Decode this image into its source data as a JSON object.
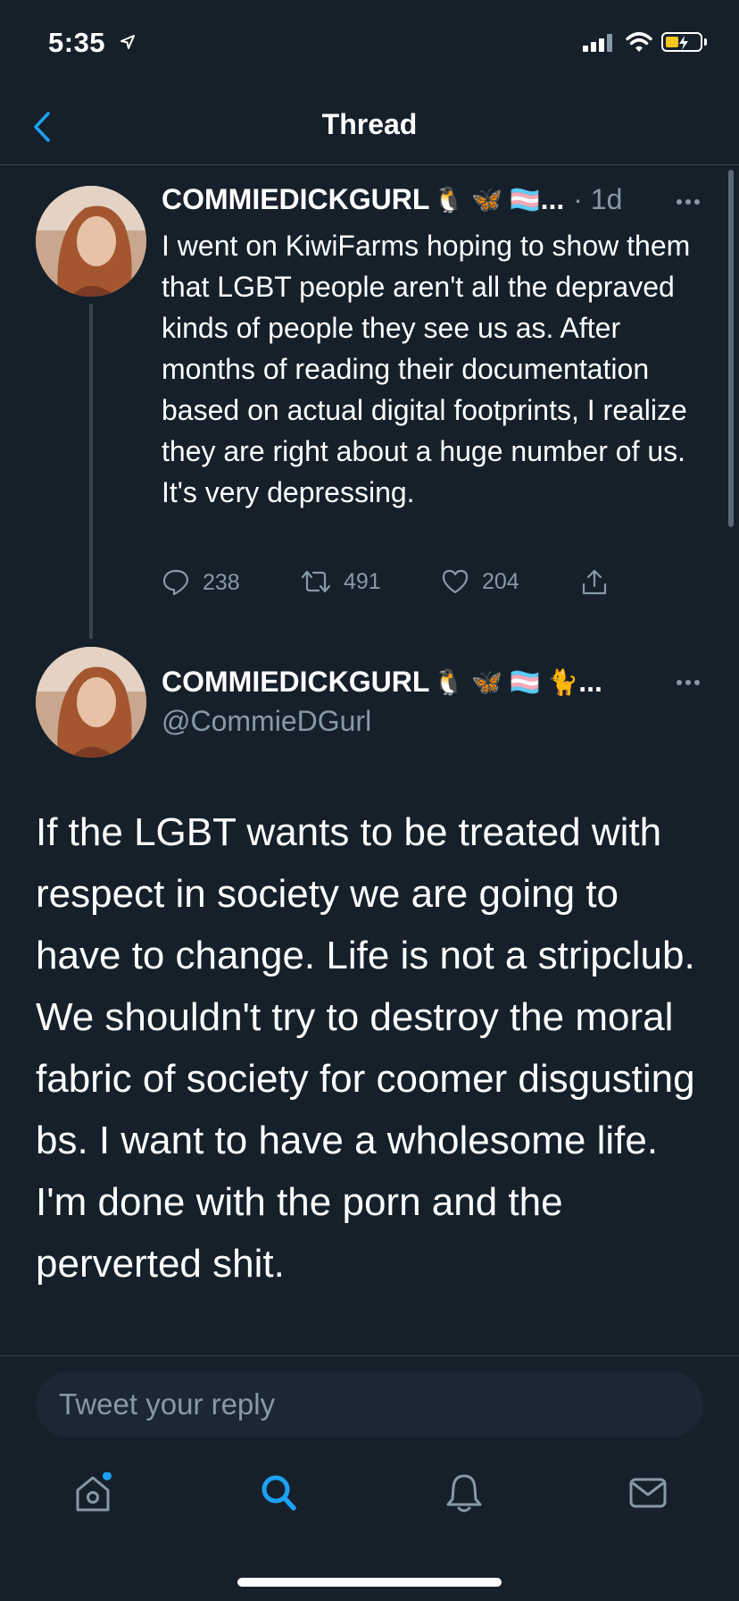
{
  "status_bar": {
    "time": "5:35"
  },
  "header": {
    "title": "Thread"
  },
  "tweets": [
    {
      "display_name": "COMMIEDICKGURL",
      "name_emojis": "🐧 🦋 🏳️‍⚧️",
      "name_ellipsis": "...",
      "time": "· 1d",
      "text": "I went on KiwiFarms hoping to show them that LGBT people aren't all the depraved kinds of people they see us as. After months of reading their documentation based on actual digital footprints, I realize they are right about a huge number of us. It's very depressing.",
      "replies": "238",
      "retweets": "491",
      "likes": "204"
    },
    {
      "display_name": "COMMIEDICKGURL",
      "name_emojis": "🐧 🦋 🏳️‍⚧️ 🐈",
      "name_ellipsis": "...",
      "handle": "@CommieDGurl",
      "text": "If the LGBT wants to be treated with respect in society we are going to have to change. Life is not a stripclub. We shouldn't try to destroy the moral fabric of society for coomer disgusting bs. I want to have a wholesome life. I'm done with the porn and the perverted shit."
    }
  ],
  "reply": {
    "placeholder": "Tweet your reply"
  },
  "tabbar": {
    "items": [
      "home-icon",
      "search-icon",
      "notifications-icon",
      "messages-icon"
    ]
  },
  "colors": {
    "background": "#15202b",
    "accent": "#1da1f2",
    "muted": "#8899a6",
    "divider": "#38444d"
  }
}
